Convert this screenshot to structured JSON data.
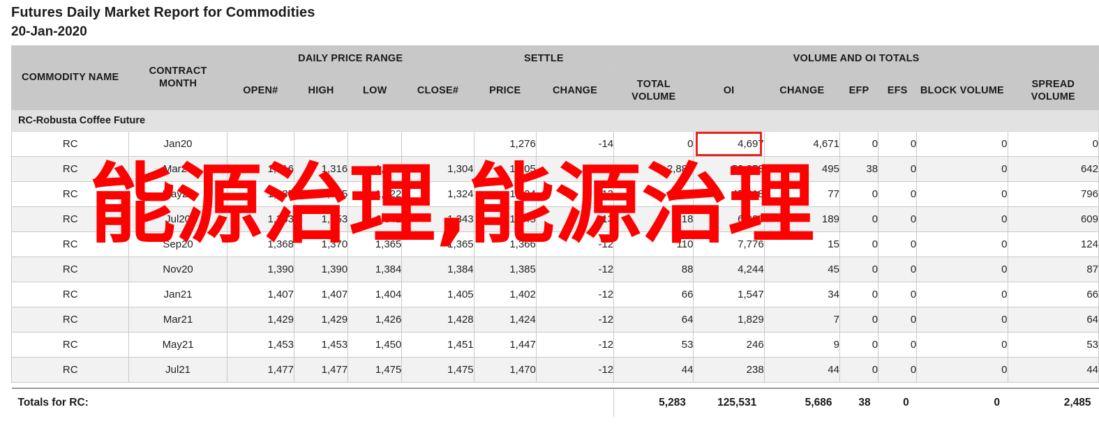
{
  "header": {
    "title": "Futures Daily Market Report for Commodities",
    "date": "20-Jan-2020"
  },
  "watermark": {
    "text": "能源治理,能源治理",
    "color": "#ff0000"
  },
  "highlight": {
    "color": "#e8251f",
    "target_row": 0,
    "target_column": "OI"
  },
  "table": {
    "group_headers": [
      {
        "label": "COMMODITY NAME",
        "colspan": 1,
        "rowspan": 2
      },
      {
        "label": "CONTRACT MONTH",
        "colspan": 1,
        "rowspan": 2
      },
      {
        "label": "DAILY PRICE RANGE",
        "colspan": 4,
        "rowspan": 1
      },
      {
        "label": "SETTLE",
        "colspan": 2,
        "rowspan": 1
      },
      {
        "label": "VOLUME AND OI TOTALS",
        "colspan": 7,
        "rowspan": 1
      }
    ],
    "sub_headers": [
      "OPEN#",
      "HIGH",
      "LOW",
      "CLOSE#",
      "PRICE",
      "CHANGE",
      "TOTAL VOLUME",
      "OI",
      "CHANGE",
      "EFP",
      "EFS",
      "BLOCK VOLUME",
      "SPREAD VOLUME"
    ],
    "column_keys": [
      "commodity",
      "month",
      "open",
      "high",
      "low",
      "close",
      "price",
      "change",
      "total_volume",
      "oi",
      "oi_change",
      "efp",
      "efs",
      "block_volume",
      "spread_volume"
    ],
    "group_row_label": "RC-Robusta Coffee Future",
    "rows": [
      {
        "commodity": "RC",
        "month": "Jan20",
        "open": "",
        "high": "",
        "low": "",
        "close": "",
        "price": "1,276",
        "change": "-14",
        "total_volume": "0",
        "oi": "4,697",
        "oi_change": "4,671",
        "efp": "0",
        "efs": "0",
        "block_volume": "0",
        "spread_volume": "0"
      },
      {
        "commodity": "RC",
        "month": "Mar20",
        "open": "1,316",
        "high": "1,316",
        "low": "1,303",
        "close": "1,304",
        "price": "1,305",
        "change": "-14",
        "total_volume": "2,884",
        "oi": "52,253",
        "oi_change": "495",
        "efp": "38",
        "efs": "0",
        "block_volume": "0",
        "spread_volume": "642"
      },
      {
        "commodity": "RC",
        "month": "May20",
        "open": "1,335",
        "high": "1,335",
        "low": "1,322",
        "close": "1,324",
        "price": "1,324",
        "change": "-13",
        "total_volume": "1,774",
        "oi": "45,818",
        "oi_change": "77",
        "efp": "0",
        "efs": "0",
        "block_volume": "0",
        "spread_volume": "796"
      },
      {
        "commodity": "RC",
        "month": "Jul20",
        "open": "1,353",
        "high": "1,353",
        "low": "1,342",
        "close": "1,343",
        "price": "1,345",
        "change": "-13",
        "total_volume": "318",
        "oi": "6,926",
        "oi_change": "189",
        "efp": "0",
        "efs": "0",
        "block_volume": "0",
        "spread_volume": "609"
      },
      {
        "commodity": "RC",
        "month": "Sep20",
        "open": "1,368",
        "high": "1,370",
        "low": "1,365",
        "close": "1,365",
        "price": "1,366",
        "change": "-12",
        "total_volume": "110",
        "oi": "7,776",
        "oi_change": "15",
        "efp": "0",
        "efs": "0",
        "block_volume": "0",
        "spread_volume": "124"
      },
      {
        "commodity": "RC",
        "month": "Nov20",
        "open": "1,390",
        "high": "1,390",
        "low": "1,384",
        "close": "1,384",
        "price": "1,385",
        "change": "-12",
        "total_volume": "88",
        "oi": "4,244",
        "oi_change": "45",
        "efp": "0",
        "efs": "0",
        "block_volume": "0",
        "spread_volume": "87"
      },
      {
        "commodity": "RC",
        "month": "Jan21",
        "open": "1,407",
        "high": "1,407",
        "low": "1,404",
        "close": "1,405",
        "price": "1,402",
        "change": "-12",
        "total_volume": "66",
        "oi": "1,547",
        "oi_change": "34",
        "efp": "0",
        "efs": "0",
        "block_volume": "0",
        "spread_volume": "66"
      },
      {
        "commodity": "RC",
        "month": "Mar21",
        "open": "1,429",
        "high": "1,429",
        "low": "1,426",
        "close": "1,428",
        "price": "1,424",
        "change": "-12",
        "total_volume": "64",
        "oi": "1,829",
        "oi_change": "7",
        "efp": "0",
        "efs": "0",
        "block_volume": "0",
        "spread_volume": "64"
      },
      {
        "commodity": "RC",
        "month": "May21",
        "open": "1,453",
        "high": "1,453",
        "low": "1,450",
        "close": "1,451",
        "price": "1,447",
        "change": "-12",
        "total_volume": "53",
        "oi": "246",
        "oi_change": "9",
        "efp": "0",
        "efs": "0",
        "block_volume": "0",
        "spread_volume": "53"
      },
      {
        "commodity": "RC",
        "month": "Jul21",
        "open": "1,477",
        "high": "1,477",
        "low": "1,475",
        "close": "1,475",
        "price": "1,470",
        "change": "-12",
        "total_volume": "44",
        "oi": "238",
        "oi_change": "44",
        "efp": "0",
        "efs": "0",
        "block_volume": "0",
        "spread_volume": "44"
      }
    ],
    "totals": {
      "label": "Totals for RC:",
      "total_volume": "5,283",
      "oi": "125,531",
      "oi_change": "5,686",
      "efp": "38",
      "efs": "0",
      "block_volume": "0",
      "spread_volume": "2,485"
    }
  }
}
